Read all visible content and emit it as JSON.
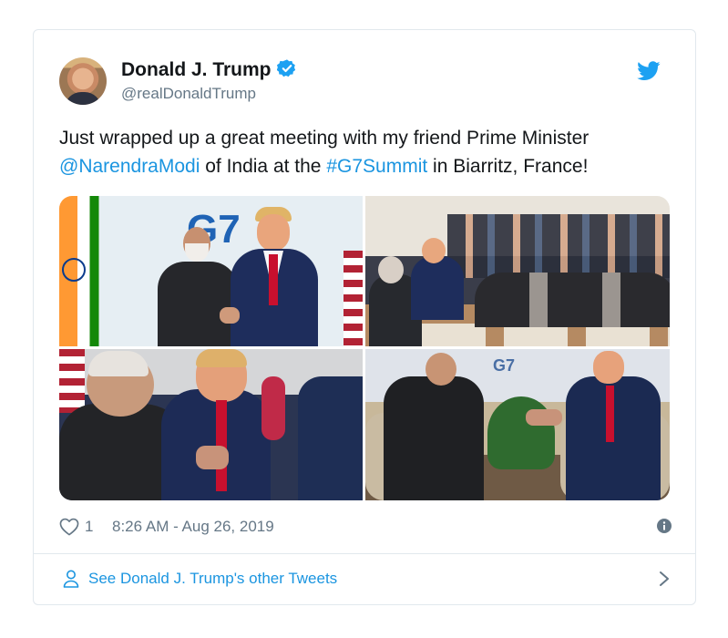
{
  "tweet": {
    "display_name": "Donald J. Trump",
    "handle": "@realDonaldTrump",
    "verified": true,
    "text_parts": {
      "line1": "Just wrapped up a great meeting with my friend Prime Minister",
      "mention": "@NarendraModi",
      "mid": " of India at the ",
      "hashtag": "#G7Summit",
      "end": " in Biarritz, France!"
    },
    "photo_overlay_text": {
      "p1_sign": "G7",
      "p4_sign": "G7"
    },
    "like_count": "1",
    "timestamp": "8:26 AM - Aug 26, 2019",
    "see_more": "See Donald J. Trump's other Tweets"
  },
  "icons": {
    "bird": "twitter-bird-icon",
    "verified": "verified-badge-icon",
    "like": "heart-icon",
    "info": "info-icon",
    "person": "person-icon",
    "chevron": "chevron-right-icon"
  },
  "colors": {
    "link": "#1b95e0",
    "text": "#14171a",
    "muted": "#657786",
    "border": "#e1e8ed",
    "brand": "#1da1f2"
  }
}
